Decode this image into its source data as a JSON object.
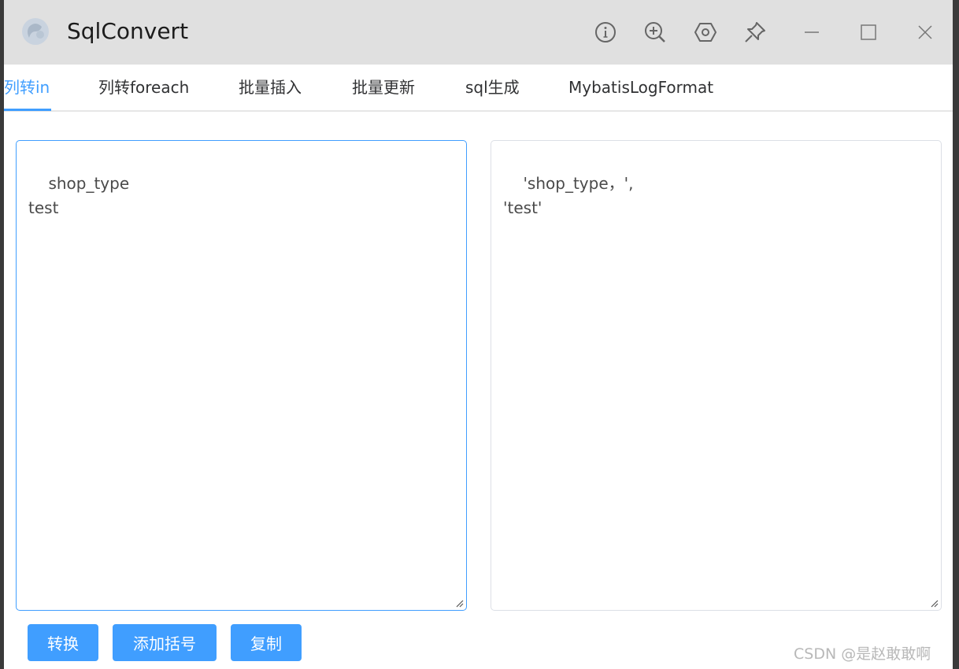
{
  "window": {
    "title": "SqlConvert"
  },
  "titlebar_icons": [
    "info-icon",
    "zoom-in-icon",
    "settings-icon",
    "pin-icon",
    "minimize-icon",
    "maximize-icon",
    "close-icon"
  ],
  "tabs": [
    {
      "label": "列转in",
      "active": true
    },
    {
      "label": "列转foreach",
      "active": false
    },
    {
      "label": "批量插入",
      "active": false
    },
    {
      "label": "批量更新",
      "active": false
    },
    {
      "label": "sql生成",
      "active": false
    },
    {
      "label": "MybatisLogFormat",
      "active": false
    }
  ],
  "input": {
    "value": "shop_type\ntest"
  },
  "output": {
    "value": "'shop_type，',\n'test'"
  },
  "buttons": {
    "convert": "转换",
    "add_parentheses": "添加括号",
    "copy": "复制"
  },
  "watermark": "CSDN @是赵敢敢啊",
  "colors": {
    "accent": "#409eff",
    "titlebar_bg": "#e0e0e0"
  }
}
